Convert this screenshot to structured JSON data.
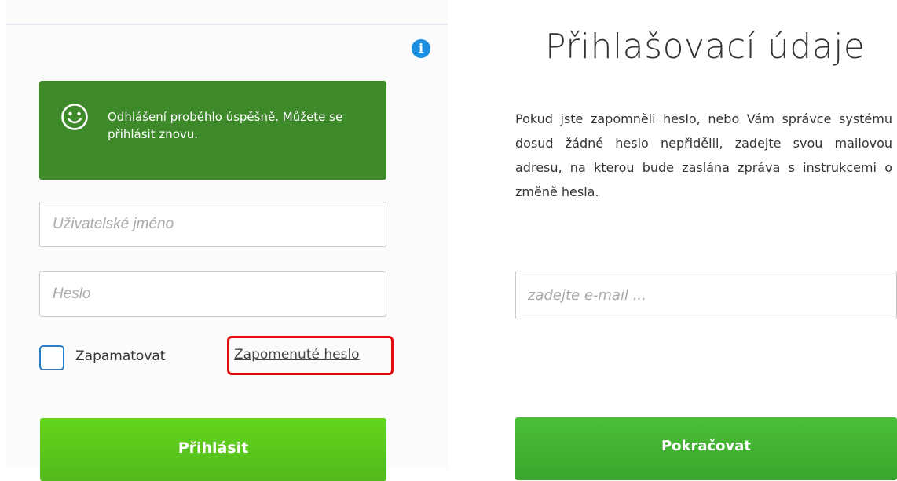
{
  "login": {
    "info_glyph": "i",
    "alert": {
      "icon": "smiley-face-icon",
      "message": "Odhlášení proběhlo úspěšně. Můžete se přihlásit znovu."
    },
    "username_placeholder": "Uživatelské jméno",
    "password_placeholder": "Heslo",
    "remember_label": "Zapamatovat",
    "forgot_link": "Zapomenuté heslo",
    "submit_label": "Přihlásit"
  },
  "recovery": {
    "title": "Přihlašovací údaje",
    "description": "Pokud jste zapomněli heslo, nebo Vám správce systému dosud žádné heslo nepřidělil, zadejte svou mailovou adresu, na kterou bude zaslána zpráva s instrukcemi o změně hesla.",
    "email_placeholder": "zadejte e-mail ...",
    "continue_label": "Pokračovat"
  },
  "colors": {
    "alert_bg": "#3e8a2a",
    "primary_button": "#5bc81c",
    "continue_button": "#43b232",
    "info_icon": "#1e8fe0",
    "highlight_border": "#e40d0d",
    "checkbox_border": "#2a7ec7"
  }
}
